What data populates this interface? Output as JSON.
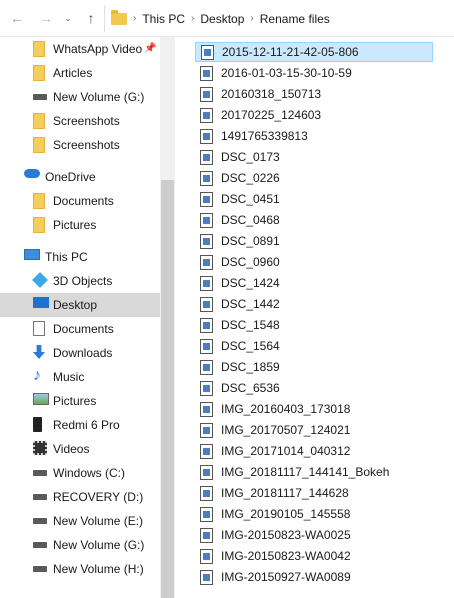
{
  "address": {
    "back_icon": "←",
    "forward_icon": "→",
    "dropdown_icon": "⌄",
    "up_icon": "↑",
    "crumbs": [
      "This PC",
      "Desktop",
      "Rename files"
    ],
    "separator": "›"
  },
  "navpane": {
    "items": [
      {
        "label": "WhatsApp Video",
        "icon": "folder-icon",
        "pinned": true
      },
      {
        "label": "Articles",
        "icon": "folder-icon"
      },
      {
        "label": "New Volume (G:)",
        "icon": "drive-icon"
      },
      {
        "label": "Screenshots",
        "icon": "folder-icon"
      },
      {
        "label": "Screenshots",
        "icon": "folder-icon"
      },
      {
        "label": "OneDrive",
        "icon": "cloud-icon"
      },
      {
        "label": "Documents",
        "icon": "folder-icon"
      },
      {
        "label": "Pictures",
        "icon": "folder-icon"
      },
      {
        "label": "This PC",
        "icon": "computer-icon"
      },
      {
        "label": "3D Objects",
        "icon": "cube-icon"
      },
      {
        "label": "Desktop",
        "icon": "desktop-icon",
        "selected": true
      },
      {
        "label": "Documents",
        "icon": "document-icon"
      },
      {
        "label": "Downloads",
        "icon": "download-icon"
      },
      {
        "label": "Music",
        "icon": "music-icon"
      },
      {
        "label": "Pictures",
        "icon": "picture-icon"
      },
      {
        "label": "Redmi 6 Pro",
        "icon": "phone-icon"
      },
      {
        "label": "Videos",
        "icon": "video-icon"
      },
      {
        "label": "Windows (C:)",
        "icon": "drive-icon"
      },
      {
        "label": "RECOVERY (D:)",
        "icon": "drive-icon"
      },
      {
        "label": "New Volume (E:)",
        "icon": "drive-icon"
      },
      {
        "label": "New Volume (G:)",
        "icon": "drive-icon"
      },
      {
        "label": "New Volume (H:)",
        "icon": "drive-icon"
      }
    ]
  },
  "files": [
    "2015-12-11-21-42-05-806",
    "2016-01-03-15-30-10-59",
    "20160318_150713",
    "20170225_124603",
    "1491765339813",
    "DSC_0173",
    "DSC_0226",
    "DSC_0451",
    "DSC_0468",
    "DSC_0891",
    "DSC_0960",
    "DSC_1424",
    "DSC_1442",
    "DSC_1548",
    "DSC_1564",
    "DSC_1859",
    "DSC_6536",
    "IMG_20160403_173018",
    "IMG_20170507_124021",
    "IMG_20171014_040312",
    "IMG_20181117_144141_Bokeh",
    "IMG_20181117_144628",
    "IMG_20190105_145558",
    "IMG-20150823-WA0025",
    "IMG-20150823-WA0042",
    "IMG-20150927-WA0089"
  ],
  "selected_file_index": 0
}
